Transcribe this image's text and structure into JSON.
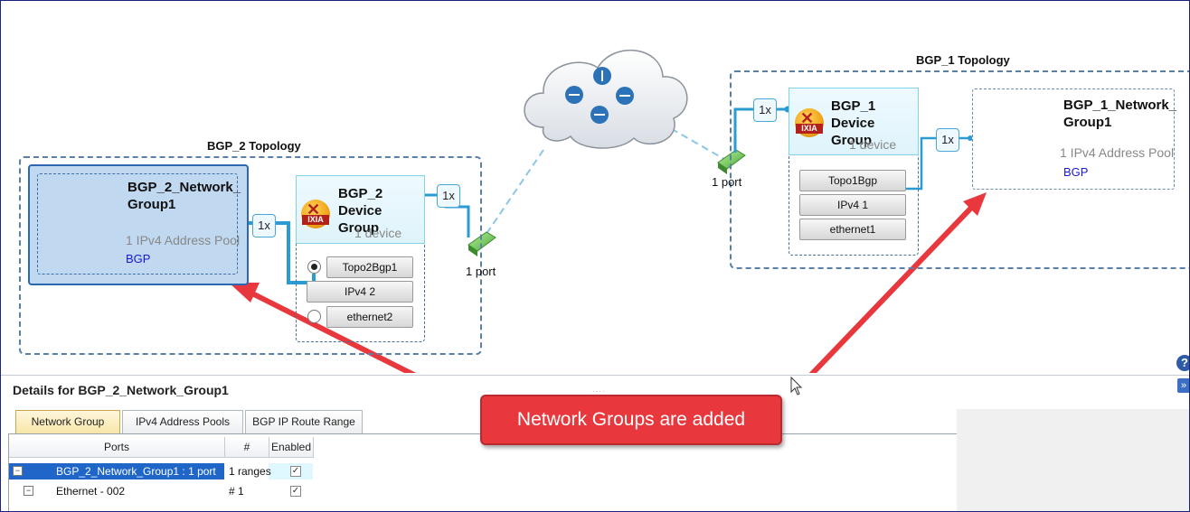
{
  "topologies": {
    "bgp2": {
      "title": "BGP_2 Topology",
      "network_group": {
        "title": "BGP_2_Network_ Group1",
        "sub": "1 IPv4 Address Pool",
        "protocol": "BGP"
      },
      "device_group": {
        "title": "BGP_2 Device Group",
        "count": "1 device",
        "logo": "IXIA"
      },
      "stack": [
        "Topo2Bgp1",
        "IPv4 2",
        "ethernet2"
      ],
      "multipliers": [
        "1x",
        "1x"
      ],
      "port": "1 port"
    },
    "bgp1": {
      "title": "BGP_1 Topology",
      "network_group": {
        "title": "BGP_1_Network_ Group1",
        "sub": "1 IPv4 Address Pool",
        "protocol": "BGP"
      },
      "device_group": {
        "title": "BGP_1 Device Group",
        "count": "1 device",
        "logo": "IXIA"
      },
      "stack": [
        "Topo1Bgp",
        "IPv4 1",
        "ethernet1"
      ],
      "multipliers": [
        "1x",
        "1x"
      ],
      "port": "1 port"
    }
  },
  "callout": "Network Groups are added",
  "details": {
    "title": "Details for BGP_2_Network_Group1",
    "tabs": [
      "Network Group",
      "IPv4 Address Pools",
      "BGP IP Route Range"
    ],
    "active_tab": "Network Group",
    "columns": [
      "Ports",
      "#",
      "Enabled"
    ],
    "rows": [
      {
        "name": "BGP_2_Network_Group1 : 1 port",
        "count": "1 ranges",
        "enabled": true,
        "expander": "−"
      },
      {
        "name": "Ethernet - 002",
        "count": "# 1",
        "enabled": true,
        "expander": "−"
      }
    ]
  },
  "colors": {
    "callout": "#e8383d",
    "arrow": "#e8383d",
    "selected_row": "#1f66c8",
    "link": "#2b9bd3",
    "topology_border": "#5a7fa8"
  },
  "icons": {
    "cloud_network": "router-cloud-icon",
    "help": "help-icon",
    "collapse": "double-chevron-down-icon",
    "port": "port-icon"
  }
}
